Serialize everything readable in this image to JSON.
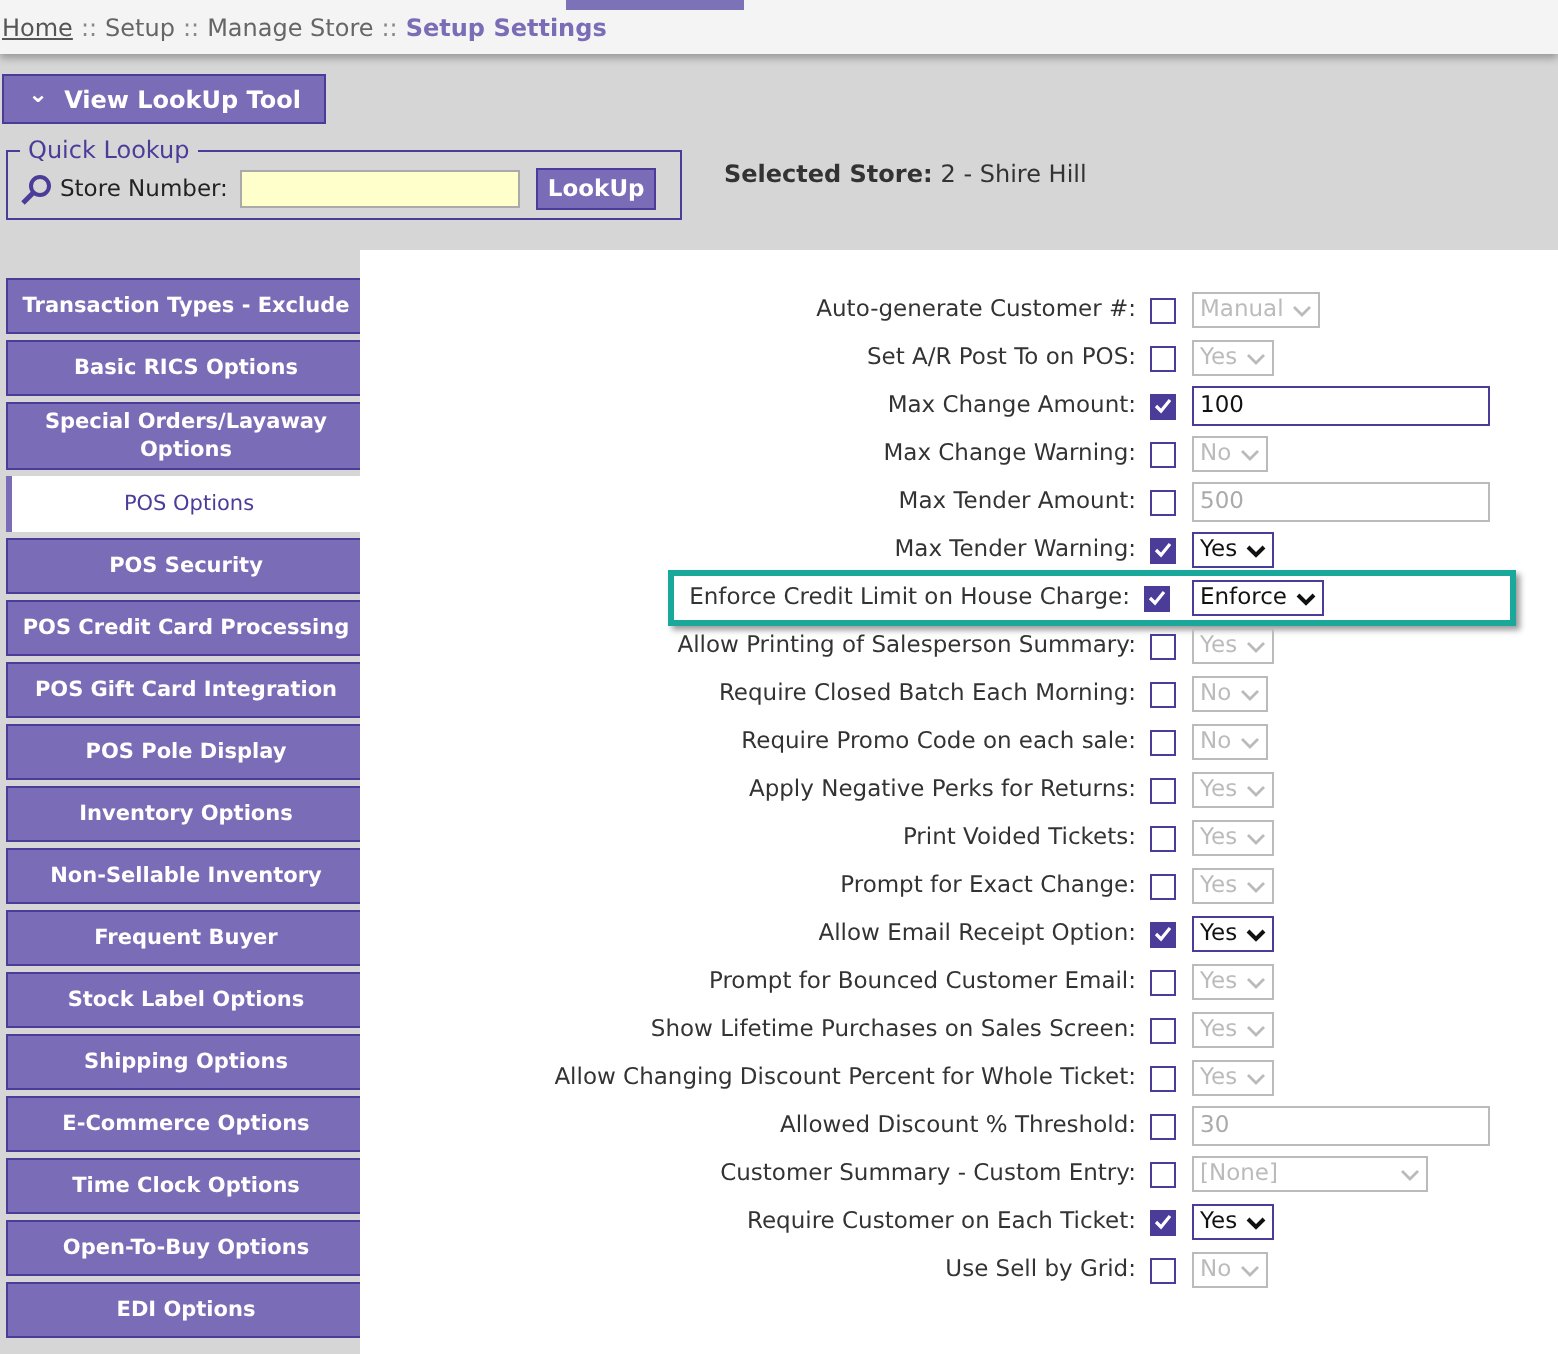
{
  "breadcrumb": [
    {
      "label": "Home",
      "kind": "link"
    },
    {
      "label": "::",
      "kind": "sep"
    },
    {
      "label": "Setup",
      "kind": "plain"
    },
    {
      "label": "::",
      "kind": "sep"
    },
    {
      "label": "Manage Store",
      "kind": "plain"
    },
    {
      "label": "::",
      "kind": "sep"
    },
    {
      "label": "Setup Settings",
      "kind": "current"
    }
  ],
  "lookup_toggle": {
    "icon": "⌄",
    "label": "View LookUp Tool"
  },
  "quick_lookup": {
    "legend": "Quick Lookup",
    "field_label": "Store Number:",
    "button": "LookUp"
  },
  "selected_store": {
    "label": "Selected Store:",
    "value": "2 - Shire Hill"
  },
  "sidebar": [
    {
      "label": "Transaction Types - Exclude",
      "selected": false
    },
    {
      "label": "Basic RICS Options",
      "selected": false
    },
    {
      "label": "Special Orders/Layaway Options",
      "selected": false
    },
    {
      "label": "POS Options",
      "selected": true
    },
    {
      "label": "POS Security",
      "selected": false
    },
    {
      "label": "POS Credit Card Processing",
      "selected": false
    },
    {
      "label": "POS Gift Card Integration",
      "selected": false
    },
    {
      "label": "POS Pole Display",
      "selected": false
    },
    {
      "label": "Inventory Options",
      "selected": false
    },
    {
      "label": "Non-Sellable Inventory",
      "selected": false
    },
    {
      "label": "Frequent Buyer",
      "selected": false
    },
    {
      "label": "Stock Label Options",
      "selected": false
    },
    {
      "label": "Shipping Options",
      "selected": false
    },
    {
      "label": "E-Commerce Options",
      "selected": false
    },
    {
      "label": "Time Clock Options",
      "selected": false
    },
    {
      "label": "Open-To-Buy Options",
      "selected": false
    },
    {
      "label": "EDI Options",
      "selected": false
    }
  ],
  "settings": [
    {
      "label": "Auto-generate Customer #:",
      "checked": false,
      "kind": "select",
      "value": "Manual",
      "highlighted": false
    },
    {
      "label": "Set A/R Post To on POS:",
      "checked": false,
      "kind": "select",
      "value": "Yes",
      "highlighted": false
    },
    {
      "label": "Max Change Amount:",
      "checked": true,
      "kind": "text",
      "value": "100",
      "highlighted": false
    },
    {
      "label": "Max Change Warning:",
      "checked": false,
      "kind": "select",
      "value": "No",
      "highlighted": false
    },
    {
      "label": "Max Tender Amount:",
      "checked": false,
      "kind": "text",
      "value": "500",
      "highlighted": false
    },
    {
      "label": "Max Tender Warning:",
      "checked": true,
      "kind": "select",
      "value": "Yes",
      "highlighted": false
    },
    {
      "label": "Enforce Credit Limit on House Charge:",
      "checked": true,
      "kind": "select",
      "value": "Enforce",
      "highlighted": true
    },
    {
      "label": "Allow Printing of Salesperson Summary:",
      "checked": false,
      "kind": "select",
      "value": "Yes",
      "highlighted": false
    },
    {
      "label": "Require Closed Batch Each Morning:",
      "checked": false,
      "kind": "select",
      "value": "No",
      "highlighted": false
    },
    {
      "label": "Require Promo Code on each sale:",
      "checked": false,
      "kind": "select",
      "value": "No",
      "highlighted": false
    },
    {
      "label": "Apply Negative Perks for Returns:",
      "checked": false,
      "kind": "select",
      "value": "Yes",
      "highlighted": false
    },
    {
      "label": "Print Voided Tickets:",
      "checked": false,
      "kind": "select",
      "value": "Yes",
      "highlighted": false
    },
    {
      "label": "Prompt for Exact Change:",
      "checked": false,
      "kind": "select",
      "value": "Yes",
      "highlighted": false
    },
    {
      "label": "Allow Email Receipt Option:",
      "checked": true,
      "kind": "select",
      "value": "Yes",
      "highlighted": false
    },
    {
      "label": "Prompt for Bounced Customer Email:",
      "checked": false,
      "kind": "select",
      "value": "Yes",
      "highlighted": false
    },
    {
      "label": "Show Lifetime Purchases on Sales Screen:",
      "checked": false,
      "kind": "select",
      "value": "Yes",
      "highlighted": false
    },
    {
      "label": "Allow Changing Discount Percent for Whole Ticket:",
      "checked": false,
      "kind": "select",
      "value": "Yes",
      "highlighted": false
    },
    {
      "label": "Allowed Discount % Threshold:",
      "checked": false,
      "kind": "text",
      "value": "30",
      "highlighted": false
    },
    {
      "label": "Customer Summary - Custom Entry:",
      "checked": false,
      "kind": "wide-select",
      "value": "[None]",
      "highlighted": false
    },
    {
      "label": "Require Customer on Each Ticket:",
      "checked": true,
      "kind": "select",
      "value": "Yes",
      "highlighted": false
    },
    {
      "label": "Use Sell by Grid:",
      "checked": false,
      "kind": "select",
      "value": "No",
      "highlighted": false
    }
  ]
}
